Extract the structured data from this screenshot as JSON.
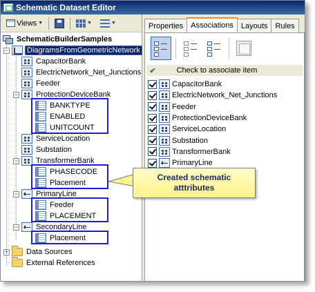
{
  "window": {
    "title": "Schematic Dataset Editor"
  },
  "toolbar": {
    "views_label": "Views"
  },
  "tree": {
    "root": "SchematicBuilderSamples",
    "diagram": "DiagramsFromGeometricNetwork",
    "items": [
      {
        "label": "CapacitorBank"
      },
      {
        "label": "ElectricNetwork_Net_Junctions"
      },
      {
        "label": "Feeder"
      },
      {
        "label": "ProtectionDeviceBank",
        "attributes": [
          "BANKTYPE",
          "ENABLED",
          "UNITCOUNT"
        ]
      },
      {
        "label": "ServiceLocation"
      },
      {
        "label": "Substation"
      },
      {
        "label": "TransformerBank",
        "attributes": [
          "PHASECODE",
          "Placement"
        ]
      },
      {
        "label": "PrimaryLine",
        "attributes": [
          "Feeder",
          "PLACEMENT"
        ]
      },
      {
        "label": "SecondaryLine",
        "attributes": [
          "Placement"
        ]
      }
    ],
    "folders": [
      "Data Sources",
      "External References"
    ]
  },
  "tabs": [
    "Properties",
    "Associations",
    "Layouts",
    "Rules"
  ],
  "active_tab": "Associations",
  "associations": {
    "hint": "Check to associate item",
    "items": [
      "CapacitorBank",
      "ElectricNetwork_Net_Junctions",
      "Feeder",
      "ProtectionDeviceBank",
      "ServiceLocation",
      "Substation",
      "TransformerBank",
      "PrimaryLine"
    ]
  },
  "callout": {
    "line1": "Created schematic",
    "line2": "atttributes"
  },
  "colors": {
    "title_bar": "#0a246a",
    "selection": "#0a246a",
    "highlight_box": "#1a1ad9",
    "callout_fill": "#fff38c"
  }
}
